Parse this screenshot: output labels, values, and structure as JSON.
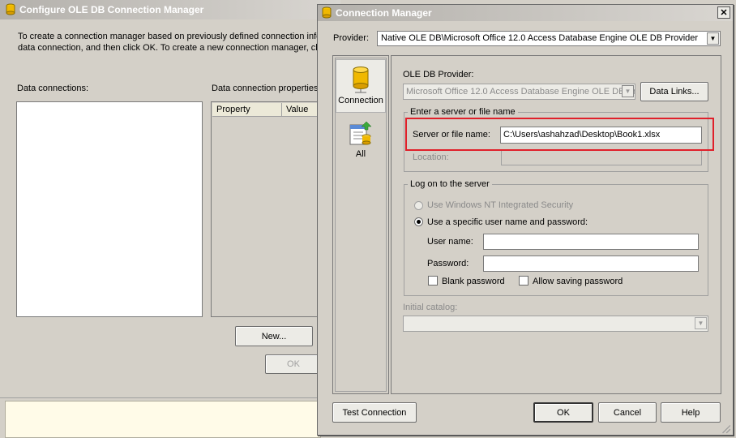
{
  "background_window": {
    "title": "Configure OLE DB Connection Manager",
    "intro_line1": "To create a connection manager based on previously defined connection info",
    "intro_line2": "data connection, and then click OK. To create a new connection manager, cli",
    "data_connections_label": "Data connections:",
    "data_connection_properties_label": "Data connection properties",
    "columns": [
      "Property",
      "Value"
    ],
    "new_button": "New...",
    "ok_button": "OK"
  },
  "dialog": {
    "title": "Connection Manager",
    "close_glyph": "✕",
    "provider_label": "Provider:",
    "provider_value": "Native OLE DB\\Microsoft Office 12.0 Access Database Engine OLE DB Provider",
    "tabs": [
      {
        "label": "Connection",
        "icon": "database-cylinder-icon"
      },
      {
        "label": "All",
        "icon": "properties-sheet-icon"
      }
    ],
    "oledb_provider_label": "OLE DB Provider:",
    "oledb_provider_value": "Microsoft Office 12.0 Access Database Engine OLE DB Provider",
    "data_links_button": "Data Links...",
    "server_group_label": "Enter a server or file name",
    "server_label": "Server or file name:",
    "server_value": "C:\\Users\\ashahzad\\Desktop\\Book1.xlsx",
    "location_label": "Location:",
    "logon_group_label": "Log on to the server",
    "radio_nt_label": "Use Windows NT Integrated Security",
    "radio_specific_label": "Use a specific user name and password:",
    "user_label": "User name:",
    "password_label": "Password:",
    "blank_password_label": "Blank password",
    "allow_saving_label": "Allow saving password",
    "initial_catalog_label": "Initial catalog:",
    "test_button": "Test Connection",
    "ok_button": "OK",
    "cancel_button": "Cancel",
    "help_button": "Help",
    "highlight_color": "#e0202a"
  }
}
